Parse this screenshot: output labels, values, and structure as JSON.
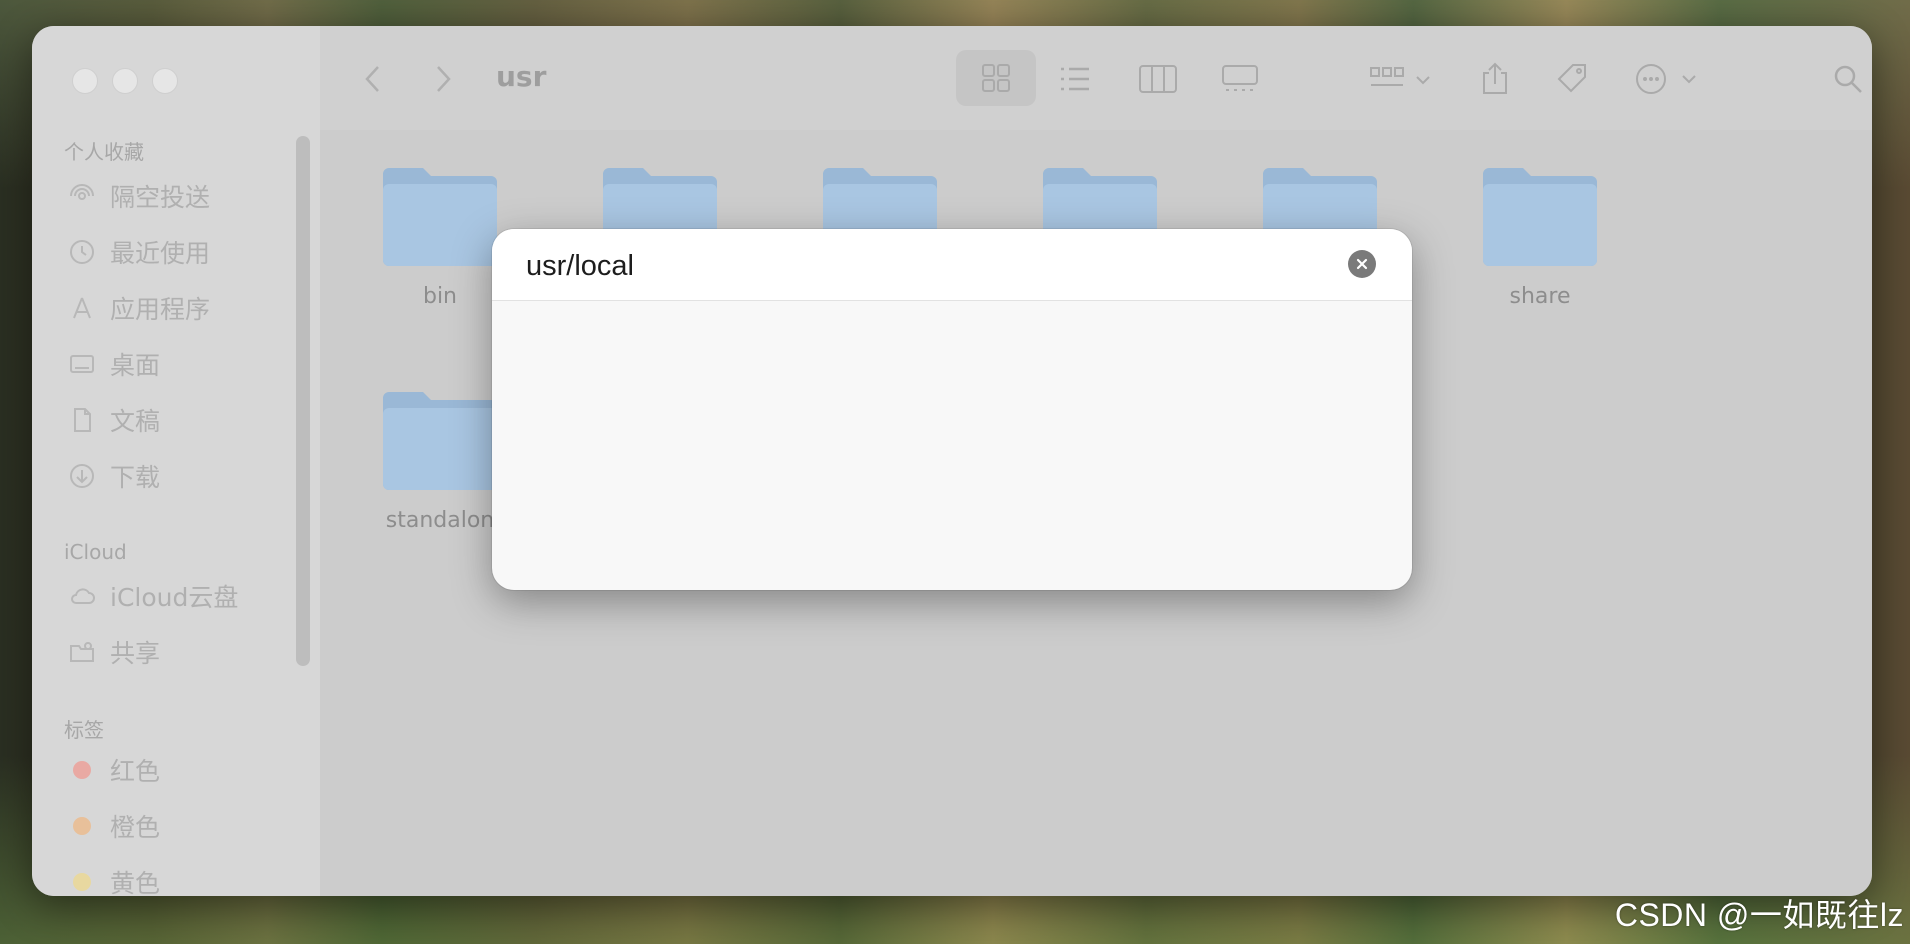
{
  "window": {
    "path_title": "usr"
  },
  "sidebar": {
    "favorites_heading": "个人收藏",
    "favorites": [
      {
        "label": "隔空投送",
        "icon": "airdrop-icon"
      },
      {
        "label": "最近使用",
        "icon": "clock-icon"
      },
      {
        "label": "应用程序",
        "icon": "applications-icon"
      },
      {
        "label": "桌面",
        "icon": "desktop-icon"
      },
      {
        "label": "文稿",
        "icon": "document-icon"
      },
      {
        "label": "下载",
        "icon": "download-icon"
      }
    ],
    "icloud_heading": "iCloud",
    "icloud": [
      {
        "label": "iCloud云盘",
        "icon": "cloud-icon"
      },
      {
        "label": "共享",
        "icon": "shared-folder-icon"
      }
    ],
    "tags_heading": "标签",
    "tags": [
      {
        "label": "红色",
        "color": "#e9a9a3"
      },
      {
        "label": "橙色",
        "color": "#e8c09a"
      },
      {
        "label": "黄色",
        "color": "#e8d8a0"
      }
    ]
  },
  "folders": [
    {
      "label": "bin"
    },
    {
      "label": ""
    },
    {
      "label": ""
    },
    {
      "label": ""
    },
    {
      "label": ""
    },
    {
      "label": "share"
    },
    {
      "label": "standalon"
    }
  ],
  "dialog": {
    "path_value": "usr/local"
  },
  "watermark": "CSDN @一如既往lz",
  "colors": {
    "folder": "#a9c6e2",
    "folder_tab": "#9ab8d6",
    "accent": "#1d1d1d"
  }
}
